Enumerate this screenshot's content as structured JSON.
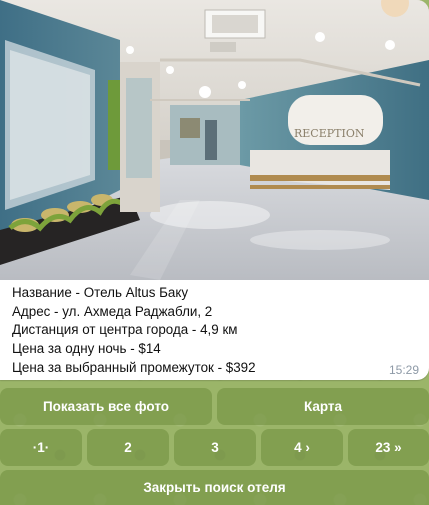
{
  "message": {
    "photo_alt_icon": "hotel-lobby-photo",
    "lines": [
      "Название - Отель Altus Баку",
      "Адрес - ул. Ахмеда Раджабли, 2",
      "Дистанция от центра города - 4,9 км",
      "Цена за одну ночь - $14",
      "Цена за выбранный промежуток - $392"
    ],
    "time": "15:29",
    "reception_sign": "RECEPTION"
  },
  "keyboard": {
    "show_all_photos": "Показать все фото",
    "map": "Карта",
    "pages": [
      "·1·",
      "2",
      "3",
      "4 ›",
      "23 »"
    ],
    "close_search": "Закрыть поиск отеля"
  },
  "colors": {
    "wallpaper": "#9bb569",
    "button_bg": "#6e8c3c",
    "time_text": "#8e9aa7"
  }
}
